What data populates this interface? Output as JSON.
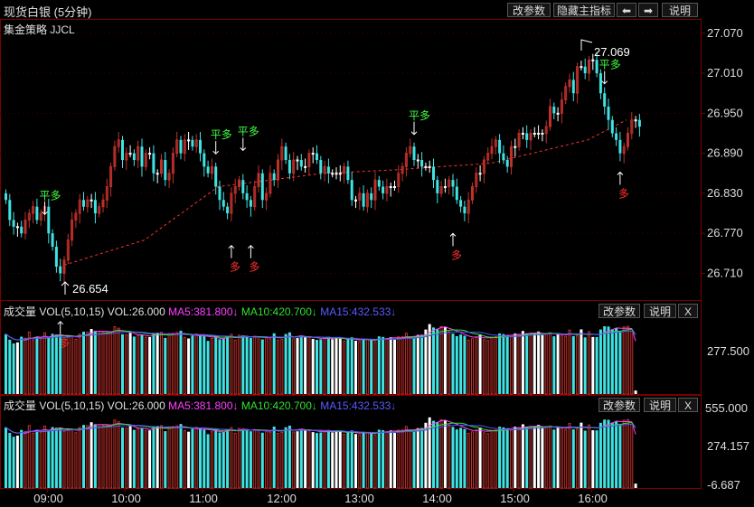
{
  "window": {
    "title": "现货白银 (5分钟)",
    "buttons": {
      "params": "改参数",
      "hide_indicator": "隐藏主指标",
      "prev": "⬅",
      "next": "➡",
      "help": "说明"
    }
  },
  "main_panel": {
    "strategy": "集金策略 JJCL",
    "price_ticks": [
      "27.070",
      "27.010",
      "26.950",
      "26.890",
      "26.830",
      "26.770",
      "26.710"
    ],
    "price_range": [
      26.67,
      27.09
    ],
    "high_label": "27.069",
    "low_label": "26.654",
    "markers": [
      {
        "text": "平多",
        "i": 10,
        "price": 26.782,
        "kind": "flat"
      },
      {
        "text": "平多",
        "i": 54,
        "price": 26.873,
        "kind": "flat"
      },
      {
        "text": "平多",
        "i": 61,
        "price": 26.878,
        "kind": "flat"
      },
      {
        "text": "平多",
        "i": 105,
        "price": 26.902,
        "kind": "flat"
      },
      {
        "text": "平多",
        "i": 154,
        "price": 26.978,
        "kind": "flat"
      },
      {
        "text": "多",
        "i": 14,
        "price": 26.654,
        "kind": "long"
      },
      {
        "text": "多",
        "i": 58,
        "price": 26.768,
        "kind": "long"
      },
      {
        "text": "多",
        "i": 63,
        "price": 26.768,
        "kind": "long"
      },
      {
        "text": "多",
        "i": 115,
        "price": 26.786,
        "kind": "long"
      },
      {
        "text": "多",
        "i": 158,
        "price": 26.878,
        "kind": "long"
      }
    ]
  },
  "vol_panel_1": {
    "title": "成交量 VOL(5,10,15) VOL:26.000",
    "ma5": "MA5:381.800↓",
    "ma10": "MA10:420.700↓",
    "ma15": "MA15:432.533↓",
    "axis_label": "277.500",
    "buttons": {
      "params": "改参数",
      "help": "说明",
      "close": "X"
    }
  },
  "vol_panel_2": {
    "title": "成交量 VOL(5,10,15) VOL:26.000",
    "ma5": "MA5:381.800↓",
    "ma10": "MA10:420.700↓",
    "ma15": "MA15:432.533↓",
    "axis_labels": [
      "555.000",
      "274.157",
      "-6.687"
    ],
    "buttons": {
      "params": "改参数",
      "help": "说明",
      "close": "X"
    }
  },
  "time_axis": [
    "09:00",
    "10:00",
    "11:00",
    "12:00",
    "13:00",
    "14:00",
    "15:00",
    "16:00"
  ],
  "colors": {
    "up": "#c0302a",
    "down": "#3fe3e3",
    "flat": "#ffffff",
    "ma5": "#ff40ff",
    "ma10": "#30e030",
    "ma15": "#5050ff",
    "signal_flat": "#40ff40",
    "signal_long": "#ff3030",
    "trend": "#ff3030"
  },
  "chart_data": {
    "type": "candlestick",
    "interval": "5min",
    "close": [
      26.82,
      26.79,
      26.78,
      26.78,
      26.77,
      26.79,
      26.8,
      26.81,
      26.79,
      26.8,
      26.81,
      26.77,
      26.75,
      26.72,
      26.71,
      26.73,
      26.76,
      26.79,
      26.8,
      26.82,
      26.81,
      26.82,
      26.82,
      26.8,
      26.81,
      26.82,
      26.84,
      26.87,
      26.9,
      26.91,
      26.88,
      26.89,
      26.89,
      26.88,
      26.9,
      26.87,
      26.89,
      26.89,
      26.86,
      26.86,
      26.88,
      26.85,
      26.86,
      26.89,
      26.91,
      26.89,
      26.91,
      26.91,
      26.9,
      26.91,
      26.89,
      26.87,
      26.86,
      26.87,
      26.84,
      26.82,
      26.81,
      26.8,
      26.83,
      26.84,
      26.85,
      26.83,
      26.82,
      26.81,
      26.84,
      26.86,
      26.82,
      26.83,
      26.86,
      26.85,
      26.88,
      26.9,
      26.88,
      26.86,
      26.88,
      26.88,
      26.87,
      26.87,
      26.89,
      26.89,
      26.88,
      26.86,
      26.87,
      26.86,
      26.86,
      26.86,
      26.86,
      26.87,
      26.85,
      26.82,
      26.82,
      26.83,
      26.81,
      26.83,
      26.82,
      26.85,
      26.84,
      26.83,
      26.84,
      26.84,
      26.84,
      26.86,
      26.87,
      26.89,
      26.9,
      26.88,
      26.88,
      26.87,
      26.87,
      26.87,
      26.85,
      26.83,
      26.84,
      26.84,
      26.85,
      26.84,
      26.82,
      26.81,
      26.8,
      26.82,
      26.84,
      26.86,
      26.86,
      26.88,
      26.89,
      26.9,
      26.91,
      26.89,
      26.88,
      26.87,
      26.9,
      26.9,
      26.92,
      26.92,
      26.91,
      26.92,
      26.92,
      26.92,
      26.92,
      26.93,
      26.96,
      26.95,
      26.95,
      26.97,
      26.99,
      27.0,
      26.98,
      27.02,
      27.02,
      27.01,
      27.03,
      27.03,
      27.01,
      26.98,
      26.96,
      26.94,
      26.92,
      26.91,
      26.89,
      26.9,
      26.92,
      26.94,
      26.94,
      26.93
    ],
    "volume": [
      442,
      401,
      373,
      381,
      423,
      412,
      456,
      400,
      420,
      406,
      452,
      421,
      444,
      439,
      440,
      413,
      425,
      427,
      403,
      442,
      460,
      456,
      480,
      466,
      454,
      458,
      456,
      460,
      497,
      486,
      441,
      437,
      452,
      424,
      432,
      438,
      419,
      420,
      451,
      452,
      455,
      414,
      447,
      449,
      454,
      467,
      418,
      410,
      432,
      443,
      438,
      426,
      392,
      410,
      425,
      404,
      411,
      428,
      441,
      399,
      435,
      432,
      428,
      413,
      421,
      422,
      403,
      422,
      406,
      448,
      398,
      405,
      443,
      455,
      408,
      413,
      430,
      420,
      423,
      407,
      400,
      404,
      417,
      423,
      405,
      412,
      409,
      391,
      407,
      419,
      393,
      388,
      408,
      402,
      400,
      386,
      425,
      421,
      410,
      419,
      401,
      422,
      423,
      449,
      419,
      411,
      436,
      438,
      476,
      516,
      491,
      478,
      498,
      496,
      461,
      446,
      427,
      439,
      430,
      399,
      409,
      422,
      441,
      402,
      396,
      420,
      423,
      447,
      442,
      434,
      422,
      447,
      441,
      465,
      448,
      446,
      447,
      461,
      435,
      445,
      452,
      426,
      445,
      435,
      425,
      472,
      427,
      428,
      477,
      418,
      460,
      421,
      420,
      476,
      500,
      498,
      478,
      487,
      467,
      496,
      500,
      463,
      26
    ]
  }
}
